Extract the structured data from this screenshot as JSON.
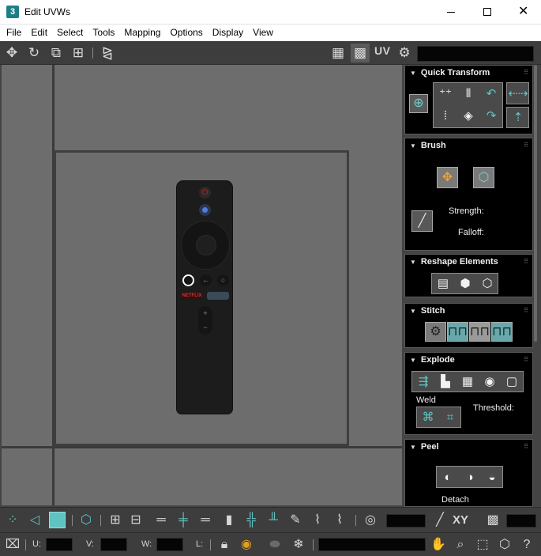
{
  "window": {
    "app_icon_label": "3",
    "title": "Edit UVWs",
    "controls": {
      "minimize": "minimize",
      "maximize": "maximize",
      "close": "✕"
    }
  },
  "menu": [
    "File",
    "Edit",
    "Select",
    "Tools",
    "Mapping",
    "Options",
    "Display",
    "View"
  ],
  "top_toolbar": {
    "icons": [
      "move-icon",
      "rotate-icon",
      "scale-icon",
      "freeform-icon",
      "mirror-icon",
      "checker-icon",
      "checker-pattern-icon",
      "uv-icon",
      "settings-icon"
    ],
    "uv_label": "UV",
    "texture_dropdown_value": ""
  },
  "viewport": {
    "remote": {
      "netflix_label": "NETFLIX",
      "volume_plus": "+",
      "volume_minus": "−"
    }
  },
  "panels": {
    "quick_transform": {
      "title": "Quick Transform"
    },
    "brush": {
      "title": "Brush",
      "strength_label": "Strength:",
      "falloff_label": "Falloff:"
    },
    "reshape_elements": {
      "title": "Reshape Elements"
    },
    "stitch": {
      "title": "Stitch"
    },
    "explode": {
      "title": "Explode",
      "weld_label": "Weld",
      "threshold_label": "Threshold:"
    },
    "peel": {
      "title": "Peel",
      "detach_label": "Detach"
    }
  },
  "bottom_toolbar": {
    "xy_label": "XY",
    "value_field": "",
    "scale_field": ""
  },
  "status_bar": {
    "u_label": "U:",
    "v_label": "V:",
    "w_label": "W:",
    "l_label": "L:",
    "u_value": "",
    "v_value": "",
    "w_value": "",
    "l_value": ""
  },
  "colors": {
    "accent": "#5fc3c2",
    "viewport_bg": "#6d6d6d",
    "panel_bg": "#000000",
    "toolbar_bg": "#3d3d3d"
  }
}
